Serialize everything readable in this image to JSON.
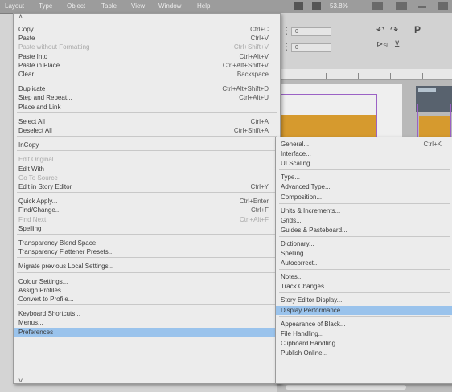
{
  "menubar": {
    "items": [
      "Layout",
      "Type",
      "Object",
      "Table",
      "View",
      "Window",
      "Help"
    ],
    "zoom_label": "53.8%"
  },
  "edit_menu": {
    "items": [
      {
        "label": "Copy",
        "shortcut": "Ctrl+C"
      },
      {
        "label": "Paste",
        "shortcut": "Ctrl+V"
      },
      {
        "label": "Paste without Formatting",
        "shortcut": "Ctrl+Shift+V",
        "disabled": true
      },
      {
        "label": "Paste Into",
        "shortcut": "Ctrl+Alt+V"
      },
      {
        "label": "Paste in Place",
        "shortcut": "Ctrl+Alt+Shift+V"
      },
      {
        "label": "Clear",
        "shortcut": "Backspace"
      },
      {
        "label": "Duplicate",
        "shortcut": "Ctrl+Alt+Shift+D",
        "sep_before": true
      },
      {
        "label": "Step and Repeat...",
        "shortcut": "Ctrl+Alt+U"
      },
      {
        "label": "Place and Link"
      },
      {
        "label": "Select All",
        "shortcut": "Ctrl+A",
        "sep_before": true
      },
      {
        "label": "Deselect All",
        "shortcut": "Ctrl+Shift+A"
      },
      {
        "label": "InCopy",
        "submenu": true,
        "sep_before": true
      },
      {
        "label": "Edit Original",
        "disabled": true,
        "sep_before": true
      },
      {
        "label": "Edit With",
        "submenu": true
      },
      {
        "label": "Go To Source",
        "disabled": true
      },
      {
        "label": "Edit in Story Editor",
        "shortcut": "Ctrl+Y"
      },
      {
        "label": "Quick Apply...",
        "shortcut": "Ctrl+Enter",
        "sep_before": true
      },
      {
        "label": "Find/Change...",
        "shortcut": "Ctrl+F"
      },
      {
        "label": "Find Next",
        "shortcut": "Ctrl+Alt+F",
        "disabled": true
      },
      {
        "label": "Spelling",
        "submenu": true
      },
      {
        "label": "Transparency Blend Space",
        "submenu": true,
        "sep_before": true
      },
      {
        "label": "Transparency Flattener Presets..."
      },
      {
        "label": "Migrate previous Local Settings...",
        "sep_before": true
      },
      {
        "label": "Colour Settings...",
        "sep_before": true
      },
      {
        "label": "Assign Profiles..."
      },
      {
        "label": "Convert to Profile..."
      },
      {
        "label": "Keyboard Shortcuts...",
        "sep_before": true
      },
      {
        "label": "Menus..."
      },
      {
        "label": "Preferences",
        "submenu": true,
        "highlighted": true
      }
    ]
  },
  "prefs_menu": {
    "items": [
      {
        "label": "General...",
        "shortcut": "Ctrl+K"
      },
      {
        "label": "Interface..."
      },
      {
        "label": "UI Scaling..."
      },
      {
        "label": "Type...",
        "sep_before": true
      },
      {
        "label": "Advanced Type..."
      },
      {
        "label": "Composition..."
      },
      {
        "label": "Units & Increments...",
        "sep_before": true
      },
      {
        "label": "Grids..."
      },
      {
        "label": "Guides & Pasteboard..."
      },
      {
        "label": "Dictionary...",
        "sep_before": true
      },
      {
        "label": "Spelling..."
      },
      {
        "label": "Autocorrect..."
      },
      {
        "label": "Notes...",
        "sep_before": true
      },
      {
        "label": "Track Changes..."
      },
      {
        "label": "Story Editor Display...",
        "sep_before": true
      },
      {
        "label": "Display Performance...",
        "highlighted": true
      },
      {
        "label": "Appearance of Black...",
        "sep_before": true
      },
      {
        "label": "File Handling..."
      },
      {
        "label": "Clipboard Handling..."
      },
      {
        "label": "Publish Online..."
      }
    ]
  },
  "control_panel": {
    "x_value": "0",
    "y_value": "0"
  },
  "colors": {
    "highlight": "#9ac3ec",
    "menu_bg": "#ececec",
    "frame": "#9b62c5",
    "orange": "#d69a2e"
  }
}
